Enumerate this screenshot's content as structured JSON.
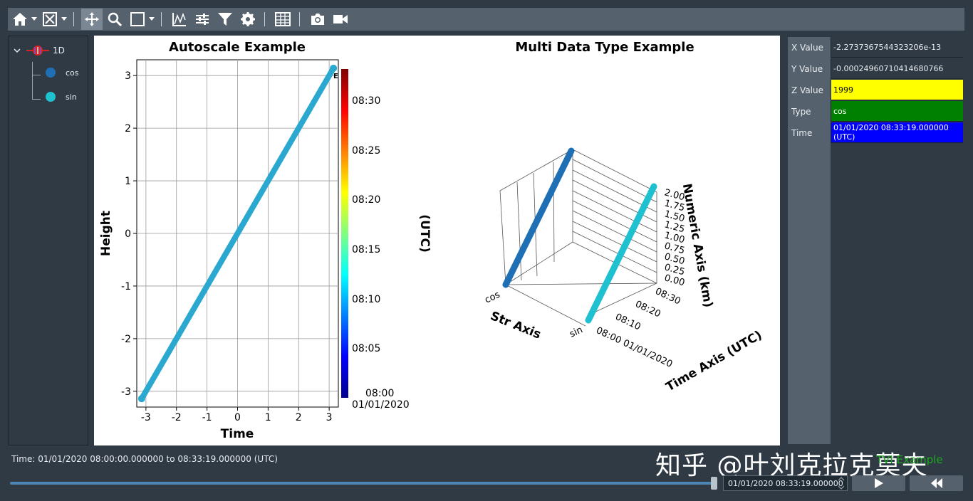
{
  "toolbar": {
    "buttons": [
      "home-icon",
      "zoom-fit-icon",
      "pan-icon",
      "zoom-icon",
      "select-box-icon",
      "line-plot-icon",
      "adjust-icon",
      "filter-icon",
      "gear-icon",
      "table-icon",
      "camera-icon",
      "video-icon"
    ]
  },
  "tree": {
    "root": "1D",
    "items": [
      {
        "label": "cos",
        "color": "#1f6fb5"
      },
      {
        "label": "sin",
        "color": "#1fc0d0"
      }
    ]
  },
  "plot_left": {
    "colorbar_label": "(UTC)",
    "colorbar_ticks": [
      "08:30",
      "08:25",
      "08:20",
      "08:15",
      "08:10",
      "08:05",
      "08:00"
    ],
    "colorbar_bottom_date": "01/01/2020",
    "cut_label": "E"
  },
  "plot_right": {
    "z_ticks": [
      "2.00",
      "1.75",
      "1.50",
      "1.25",
      "1.00",
      "0.75",
      "0.50",
      "0.25",
      "0.00"
    ],
    "time_ticks": [
      "08:30",
      "08:20",
      "08:10"
    ],
    "time_origin": "08:00 01/01/2020",
    "str_ticks": [
      "cos",
      "sin"
    ]
  },
  "chart_data": [
    {
      "type": "scatter",
      "title": "Autoscale Example",
      "xlabel": "Time",
      "ylabel": "Height",
      "xlim": [
        -3.3,
        3.3
      ],
      "ylim": [
        -3.3,
        3.3
      ],
      "xticks": [
        -3,
        -2,
        -1,
        0,
        1,
        2,
        3
      ],
      "yticks": [
        -3,
        -2,
        -1,
        0,
        1,
        2,
        3
      ],
      "grid": true,
      "series": [
        {
          "x": [
            -3.14,
            3.14
          ],
          "y": [
            -3.14,
            3.14
          ]
        }
      ]
    },
    {
      "type": "line",
      "title": "Multi Data Type Example",
      "xlabel": "Str Axis",
      "ylabel": "Time Axis (UTC)",
      "zlabel": "Numeric Axis (km)",
      "series": [
        {
          "name": "cos",
          "color": "#1f6fb5"
        },
        {
          "name": "sin",
          "color": "#1fc0d0"
        }
      ]
    }
  ],
  "properties": [
    {
      "name": "X Value",
      "value": "-2.2737367544323206e-13",
      "bg": "#2f3a45",
      "fg": "#e8ecef"
    },
    {
      "name": "Y Value",
      "value": "-0.00024960710414680766",
      "bg": "#2f3a45",
      "fg": "#e8ecef"
    },
    {
      "name": "Z Value",
      "value": "1999",
      "bg": "#ffff00",
      "fg": "#000000"
    },
    {
      "name": "Type",
      "value": "cos",
      "bg": "#008000",
      "fg": "#ffffff"
    },
    {
      "name": "Time",
      "value": "01/01/2020 08:33:19.000000 (UTC)",
      "bg": "#0000ff",
      "fg": "#ffffff"
    }
  ],
  "footer": {
    "time_range": "Time: 01/01/2020 08:00:00.000000 to 08:33:19.000000 (UTC)",
    "current_time": "01/01/2020 08:33:19.000000",
    "slider_fraction": 0.998,
    "watermark": "知乎 @叶刘克拉克莫夫",
    "corner_text": "TVI Example"
  }
}
